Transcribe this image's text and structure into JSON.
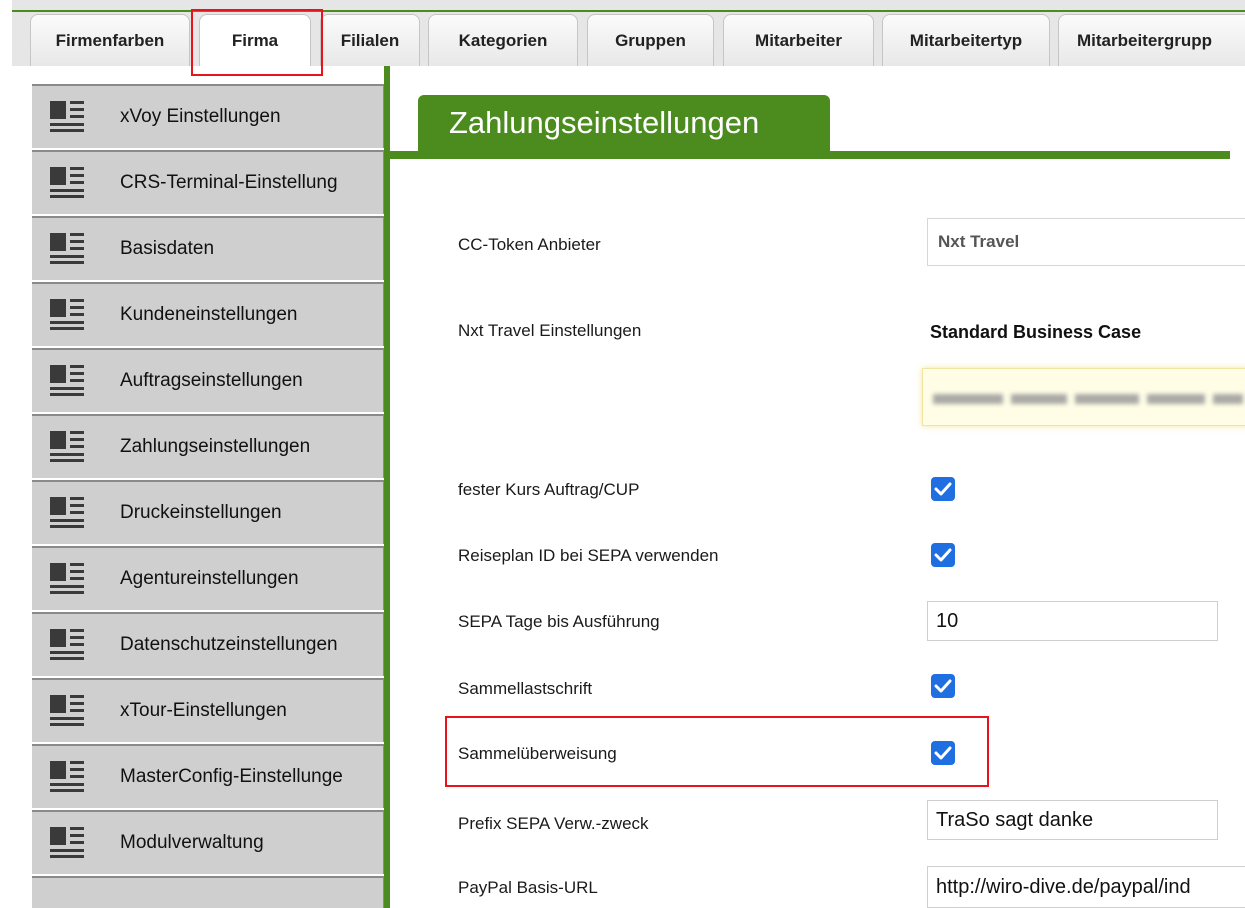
{
  "tabs": [
    {
      "label": "Firmenfarben",
      "active": false
    },
    {
      "label": "Firma",
      "active": true
    },
    {
      "label": "Filialen",
      "active": false
    },
    {
      "label": "Kategorien",
      "active": false
    },
    {
      "label": "Gruppen",
      "active": false
    },
    {
      "label": "Mitarbeiter",
      "active": false
    },
    {
      "label": "Mitarbeitertyp",
      "active": false
    },
    {
      "label": "Mitarbeitergrupp",
      "active": false
    }
  ],
  "sidebar": {
    "items": [
      {
        "label": "xVoy Einstellungen"
      },
      {
        "label": "CRS-Terminal-Einstellung"
      },
      {
        "label": "Basisdaten"
      },
      {
        "label": "Kundeneinstellungen"
      },
      {
        "label": "Auftragseinstellungen"
      },
      {
        "label": "Zahlungseinstellungen"
      },
      {
        "label": "Druckeinstellungen"
      },
      {
        "label": "Agentureinstellungen"
      },
      {
        "label": "Datenschutzeinstellungen"
      },
      {
        "label": "xTour-Einstellungen"
      },
      {
        "label": "MasterConfig-Einstellunge"
      },
      {
        "label": "Modulverwaltung"
      }
    ]
  },
  "panel": {
    "title": "Zahlungseinstellungen",
    "cc_token": {
      "label": "CC-Token Anbieter",
      "value": "Nxt Travel"
    },
    "nxt_settings": {
      "label": "Nxt Travel Einstellungen",
      "value": "Standard Business Case"
    },
    "fixed_rate": {
      "label": "fester Kurs Auftrag/CUP",
      "checked": true
    },
    "reiseplan_id": {
      "label": "Reiseplan ID bei SEPA verwenden",
      "checked": true
    },
    "sepa_days": {
      "label": "SEPA Tage bis Ausführung",
      "value": "10"
    },
    "sammellastschrift": {
      "label": "Sammellastschrift",
      "checked": true
    },
    "sammelueberweisung": {
      "label": "Sammelüberweisung",
      "checked": true
    },
    "prefix": {
      "label": "Prefix SEPA Verw.-zweck",
      "value": "TraSo sagt danke"
    },
    "paypal": {
      "label": "PayPal Basis-URL",
      "value": "http://wiro-dive.de/paypal/ind"
    }
  },
  "colors": {
    "accent_green": "#4c8c1f",
    "highlight_red": "#e8131b",
    "checkbox_blue": "#1f6fe0"
  }
}
